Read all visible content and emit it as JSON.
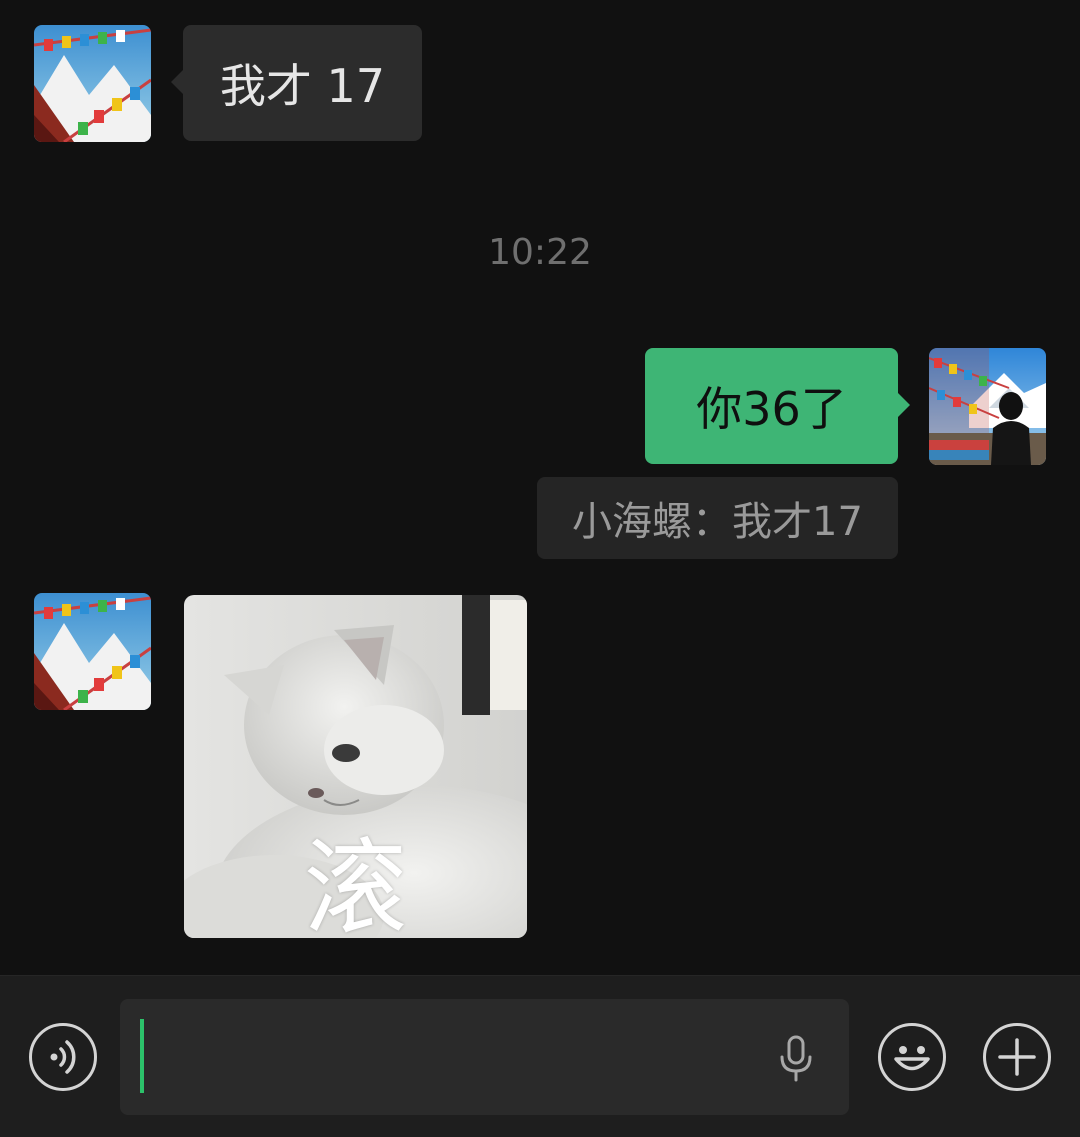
{
  "messages": {
    "first": {
      "text": "我才 17"
    },
    "timestamp": "10:22",
    "reply": {
      "text": "你36了"
    },
    "quote": {
      "text": "小海螺：我才17"
    },
    "sticker": {
      "caption": "滚"
    }
  },
  "input_bar": {
    "text_value": "",
    "left_icon": "voice-mode-icon",
    "field_icon": "microphone-icon",
    "emoji_icon": "emoji-icon",
    "plus_icon": "plus-icon"
  },
  "colors": {
    "background": "#111111",
    "incoming_bubble": "#2c2c2c",
    "outgoing_bubble": "#3eb575",
    "caret": "#2cc16a"
  }
}
